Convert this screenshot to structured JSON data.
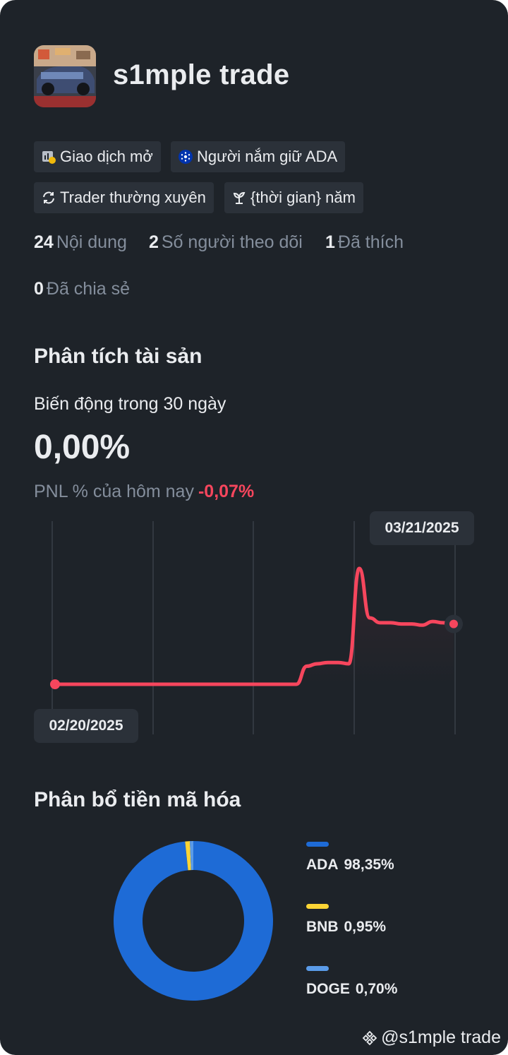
{
  "profile": {
    "name": "s1mple trade"
  },
  "tags": [
    {
      "icon": "chart-badge-icon",
      "label": "Giao dịch mở"
    },
    {
      "icon": "ada-coin-icon",
      "label": "Người nắm giữ ADA"
    },
    {
      "icon": "repeat-icon",
      "label": "Trader thường xuyên"
    },
    {
      "icon": "sprout-icon",
      "label": "{thời gian} năm"
    }
  ],
  "stats": [
    {
      "value": "24",
      "label": "Nội dung"
    },
    {
      "value": "2",
      "label": "Số người theo dõi"
    },
    {
      "value": "1",
      "label": "Đã thích"
    },
    {
      "value": "0",
      "label": "Đã chia sẻ"
    }
  ],
  "analysis": {
    "title": "Phân tích tài sản",
    "subtitle": "Biến động trong 30 ngày",
    "change": "0,00%",
    "pnl_label": "PNL % của hôm nay",
    "pnl_value": "-0,07%"
  },
  "colors": {
    "background": "#1e2329",
    "line": "#f6465d",
    "negative": "#f6465d",
    "ada": "#1e6bd6",
    "bnb": "#fcd535",
    "doge": "#5a9be8"
  },
  "chart_data": [
    {
      "type": "line",
      "x_start_label": "02/20/2025",
      "x_end_label": "03/21/2025",
      "values": [
        0,
        0,
        0,
        0,
        0,
        0,
        0,
        0,
        0,
        0,
        0,
        0,
        0,
        0,
        0,
        0,
        0,
        0,
        0,
        0,
        0,
        0,
        0,
        0,
        0.15,
        0.17,
        0.18,
        0.18,
        0.17,
        0.96,
        0.55,
        0.51,
        0.51,
        0.5,
        0.5,
        0.49,
        0.52,
        0.51,
        0.5
      ],
      "grid": true
    },
    {
      "type": "pie",
      "title": "Phân bổ tiền mã hóa",
      "slices": [
        {
          "name": "ADA",
          "value": 98.35,
          "label": "98,35%"
        },
        {
          "name": "BNB",
          "value": 0.95,
          "label": "0,95%"
        },
        {
          "name": "DOGE",
          "value": 0.7,
          "label": "0,70%"
        }
      ]
    }
  ],
  "footer": {
    "handle": "@s1mple trade"
  }
}
